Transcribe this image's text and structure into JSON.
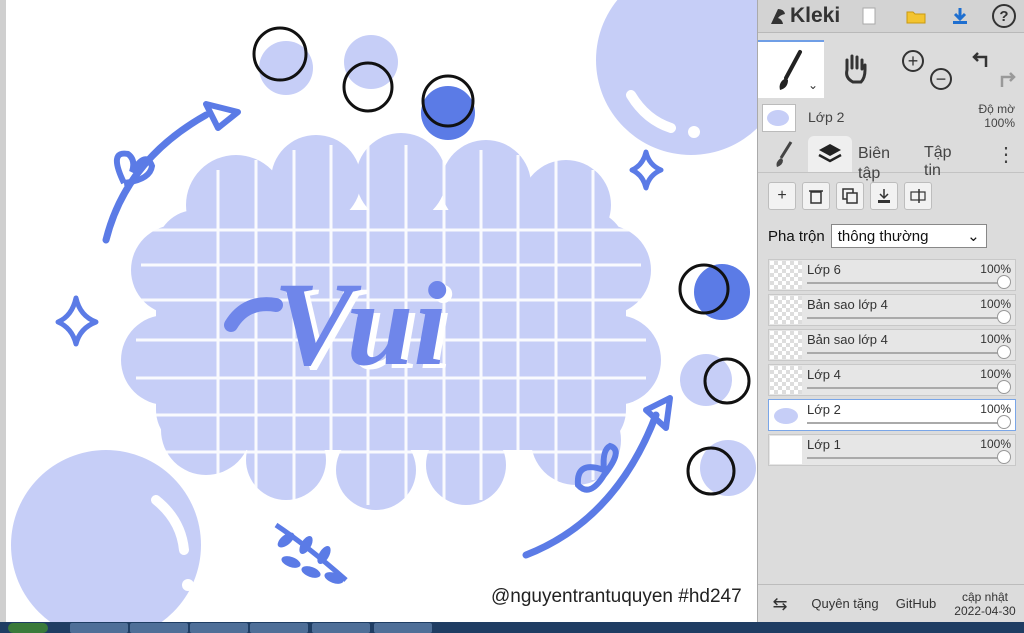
{
  "app": {
    "name": "Kleki"
  },
  "canvas": {
    "watermark": "@nguyentrantuquyen #hd247",
    "title_text": "Vui"
  },
  "toolbar": {
    "icons": [
      "new-image-icon",
      "open-folder-icon",
      "download-icon",
      "help-icon"
    ],
    "help_label": "?",
    "tools": [
      "brush-tool-icon",
      "hand-tool-icon",
      "zoom-in-icon",
      "zoom-out-icon",
      "undo-icon",
      "redo-icon"
    ]
  },
  "current_layer": {
    "name": "Lớp 2",
    "opacity_label": "Độ mờ",
    "opacity_value": "100%"
  },
  "tabs": {
    "edit": "Biên tập",
    "file": "Tập tin"
  },
  "layer_actions": [
    "add-layer",
    "delete-layer",
    "duplicate-layer",
    "merge-down",
    "rename-layer"
  ],
  "blend": {
    "label": "Pha trộn",
    "value": "thông thường"
  },
  "layers": [
    {
      "name": "Lớp 6",
      "opacity": "100%",
      "selected": false
    },
    {
      "name": "Bản sao lớp 4",
      "opacity": "100%",
      "selected": false
    },
    {
      "name": "Bản sao lớp 4",
      "opacity": "100%",
      "selected": false
    },
    {
      "name": "Lớp 4",
      "opacity": "100%",
      "selected": false
    },
    {
      "name": "Lớp 2",
      "opacity": "100%",
      "selected": true
    },
    {
      "name": "Lớp 1",
      "opacity": "100%",
      "selected": false
    }
  ],
  "footer": {
    "donate": "Quyên tặng",
    "github": "GitHub",
    "update_line1": "cập nhật",
    "update_line2": "2022-04-30"
  },
  "colors": {
    "accent": "#5b7be6",
    "light": "#c6cef7",
    "panel": "#dcdcdc"
  }
}
